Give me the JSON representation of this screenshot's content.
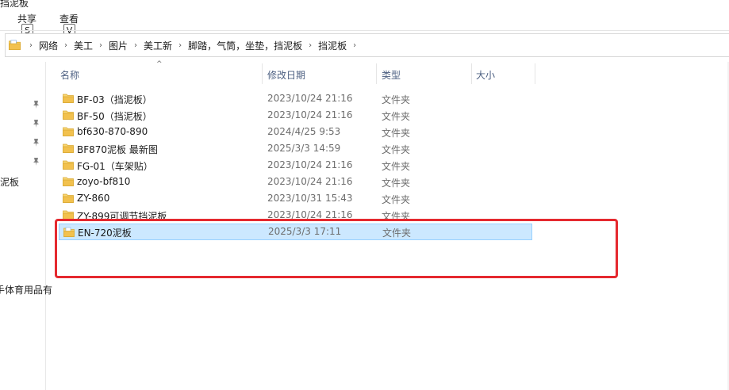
{
  "window": {
    "title_fragment": "挡泥板"
  },
  "ribbon": {
    "tabs": [
      {
        "label": "共享",
        "keytip": "S"
      },
      {
        "label": "查看",
        "keytip": "V"
      }
    ]
  },
  "address": {
    "breadcrumbs": [
      "网络",
      "美工",
      "图片",
      "美工新",
      "脚踏，气筒，坐垫，挡泥板",
      "挡泥板"
    ],
    "separator": "›"
  },
  "nav_pane": {
    "fragments": [
      "泥板",
      "手体育用品有"
    ]
  },
  "columns": {
    "name": "名称",
    "date": "修改日期",
    "type": "类型",
    "size": "大小",
    "sort_indicator": "^"
  },
  "rows": [
    {
      "name": "BF-03（挡泥板）",
      "date": "2023/10/24 21:16",
      "type": "文件夹"
    },
    {
      "name": "BF-50（挡泥板）",
      "date": "2023/10/24 21:16",
      "type": "文件夹"
    },
    {
      "name": "bf630-870-890",
      "date": "2024/4/25 9:53",
      "type": "文件夹"
    },
    {
      "name": "BF870泥板 最新图",
      "date": "2025/3/3 14:59",
      "type": "文件夹"
    },
    {
      "name": "FG-01（车架贴）",
      "date": "2023/10/24 21:16",
      "type": "文件夹"
    },
    {
      "name": "zoyo-bf810",
      "date": "2023/10/24 21:16",
      "type": "文件夹"
    },
    {
      "name": "ZY-860",
      "date": "2023/10/31 15:43",
      "type": "文件夹"
    },
    {
      "name": "ZY-899可调节挡泥板",
      "date": "2023/10/24 21:16",
      "type": "文件夹"
    },
    {
      "name": "EN-720泥板",
      "date": "2025/3/3 17:11",
      "type": "文件夹",
      "selected": true
    }
  ],
  "colors": {
    "selection_bg": "#cce8ff",
    "selection_border": "#99d1ff",
    "annotation_red": "#e5292f",
    "folder_yellow": "#f8d775"
  },
  "icons": {
    "folder": "folder-icon",
    "pin": "pin-icon",
    "breadcrumb_separator": "chevron-right-icon"
  }
}
